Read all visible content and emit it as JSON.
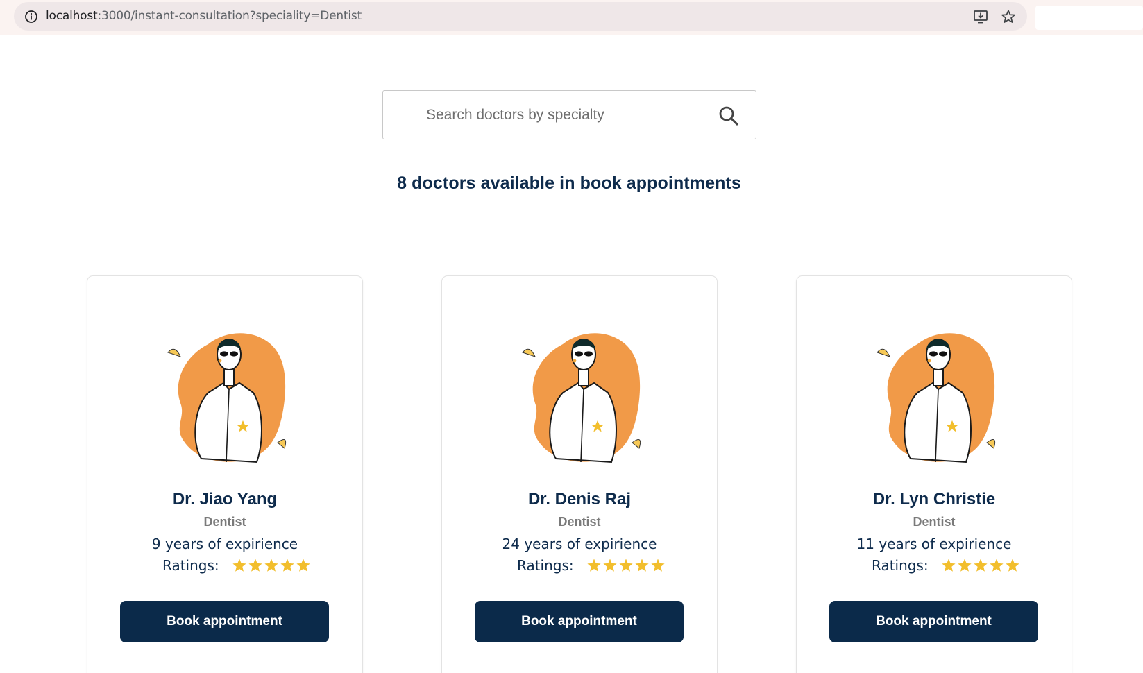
{
  "browser": {
    "url_host": "localhost",
    "url_rest": ":3000/instant-consultation?speciality=Dentist",
    "site_info_icon": "info-icon",
    "install_icon": "install-app-icon",
    "bookmark_icon": "star-outline-icon"
  },
  "search": {
    "placeholder": "Search doctors by specialty",
    "value": "",
    "icon": "search-icon"
  },
  "results": {
    "heading": "8 doctors available in book appointments"
  },
  "doctors": [
    {
      "name": "Dr. Jiao Yang",
      "specialty": "Dentist",
      "experience": "9 years of expirience",
      "ratings_label": "Ratings:",
      "rating": 5,
      "button": "Book appointment"
    },
    {
      "name": "Dr. Denis Raj",
      "specialty": "Dentist",
      "experience": "24 years of expirience",
      "ratings_label": "Ratings:",
      "rating": 5,
      "button": "Book appointment"
    },
    {
      "name": "Dr. Lyn Christie",
      "specialty": "Dentist",
      "experience": "11 years of expirience",
      "ratings_label": "Ratings:",
      "rating": 5,
      "button": "Book appointment"
    }
  ],
  "colors": {
    "primary": "#0b2a4a",
    "star": "#f2be2c",
    "avatar_blob": "#f19a48",
    "muted_text": "#7a7a7a"
  }
}
